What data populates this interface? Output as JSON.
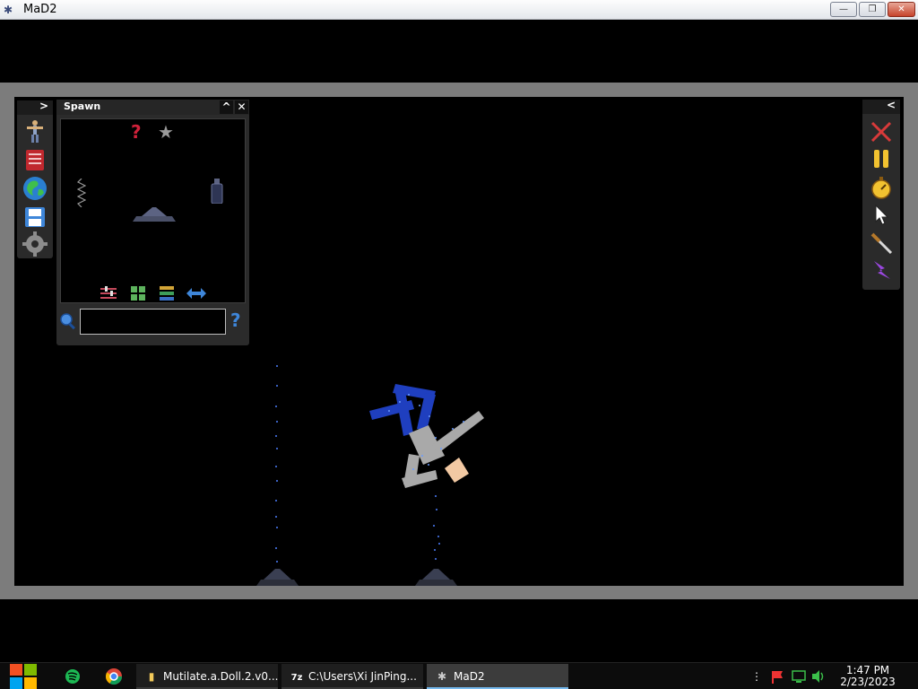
{
  "window": {
    "title": "MaD2",
    "app_icon": "mad2-app-icon",
    "minimize_label": "—",
    "maximize_label": "❐",
    "close_label": "✕"
  },
  "left_toolbar": {
    "collapse_glyph": ">",
    "items": [
      {
        "icon": "ragdoll-icon"
      },
      {
        "icon": "book-icon"
      },
      {
        "icon": "globe-icon"
      },
      {
        "icon": "save-icon"
      },
      {
        "icon": "gear-icon"
      }
    ]
  },
  "spawn_panel": {
    "title": "Spawn",
    "minimize_glyph": "^",
    "close_glyph": "✕",
    "search_value": "",
    "search_icon": "search-icon",
    "help_glyph": "?",
    "items": [
      {
        "icon": "random-question-icon",
        "glyph": "?"
      },
      {
        "icon": "favorites-star-icon",
        "glyph": "★"
      },
      {
        "icon": "spring-icon"
      },
      {
        "icon": "launcher-pad-icon"
      },
      {
        "icon": "bottle-icon"
      }
    ],
    "filters": [
      {
        "icon": "sliders-icon"
      },
      {
        "icon": "grid-view-icon"
      },
      {
        "icon": "list-view-icon"
      },
      {
        "icon": "swap-arrows-icon"
      }
    ]
  },
  "right_toolbar": {
    "collapse_glyph": "<",
    "items": [
      {
        "icon": "delete-x-icon"
      },
      {
        "icon": "pause-icon"
      },
      {
        "icon": "stopwatch-icon"
      },
      {
        "icon": "cursor-icon"
      },
      {
        "icon": "knife-icon"
      },
      {
        "icon": "lightning-icon"
      }
    ]
  },
  "taskbar": {
    "tasks": [
      {
        "label": "Mutilate.a.Doll.2.v0...",
        "icon": "folder-icon"
      },
      {
        "label": "C:\\Users\\Xi JinPing...",
        "icon": "7zip-icon"
      },
      {
        "label": "MaD2",
        "icon": "mad2-app-icon",
        "active": true
      }
    ],
    "clock_time": "1:47 PM",
    "clock_date": "2/23/2023"
  },
  "colors": {
    "background": "#000000",
    "frame": "#7c7c7c",
    "panel": "#2b2b2b",
    "taskbar": "#0c0c0c",
    "accent_active": "#76b9ed"
  }
}
